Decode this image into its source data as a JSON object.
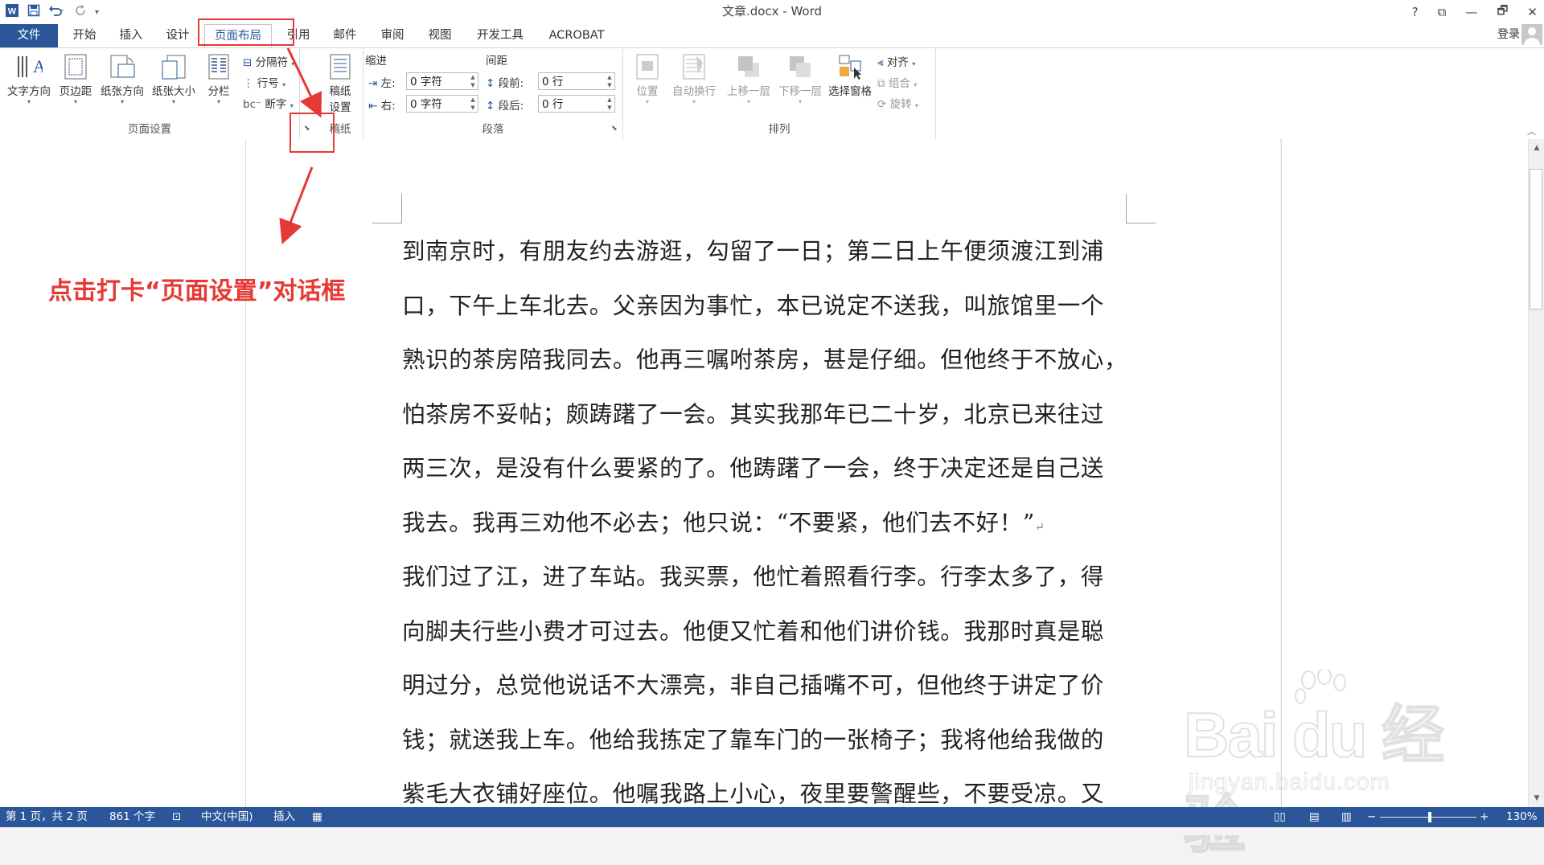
{
  "window": {
    "title": "文章.docx - Word",
    "controls": [
      "?",
      "⧉",
      "—",
      "🗗",
      "✕"
    ]
  },
  "tabs": [
    {
      "label": "文件",
      "active": false
    },
    {
      "label": "开始",
      "active": false
    },
    {
      "label": "插入",
      "active": false
    },
    {
      "label": "设计",
      "active": false
    },
    {
      "label": "页面布局",
      "active": true
    },
    {
      "label": "引用",
      "active": false
    },
    {
      "label": "邮件",
      "active": false
    },
    {
      "label": "审阅",
      "active": false
    },
    {
      "label": "视图",
      "active": false
    },
    {
      "label": "开发工具",
      "active": false
    },
    {
      "label": "ACROBAT",
      "active": false
    }
  ],
  "account": {
    "login": "登录"
  },
  "ribbon": {
    "page_setup": {
      "label": "页面设置",
      "text_direction": "文字方向",
      "margins": "页边距",
      "orientation": "纸张方向",
      "size": "纸张大小",
      "columns": "分栏",
      "breaks": "分隔符",
      "line_numbers": "行号",
      "hyphenation": "断字"
    },
    "draft_paper": {
      "label": "稿纸",
      "settings_line1": "稿纸",
      "settings_line2": "设置"
    },
    "paragraph": {
      "label": "段落",
      "indent_header": "缩进",
      "spacing_header": "间距",
      "indent_left_label": "左:",
      "indent_left_value": "0 字符",
      "indent_right_label": "右:",
      "indent_right_value": "0 字符",
      "spacing_before_label": "段前:",
      "spacing_before_value": "0 行",
      "spacing_after_label": "段后:",
      "spacing_after_value": "0 行"
    },
    "arrange": {
      "label": "排列",
      "position": "位置",
      "wrap_text": "自动换行",
      "bring_forward": "上移一层",
      "send_backward": "下移一层",
      "selection_pane": "选择窗格",
      "align": "对齐",
      "group": "组合",
      "rotate": "旋转"
    }
  },
  "document": {
    "lines": [
      "到南京时，有朋友约去游逛，勾留了一日；第二日上午便须渡江到浦",
      "口，下午上车北去。父亲因为事忙，本已说定不送我，叫旅馆里一个",
      "熟识的茶房陪我同去。他再三嘱咐茶房，甚是仔细。但他终于不放心，",
      "怕茶房不妥帖；颇踌躇了一会。其实我那年已二十岁，北京已来往过",
      "两三次，是没有什么要紧的了。他踌躇了一会，终于决定还是自己送",
      "我去。我再三劝他不必去；他只说：“不要紧，他们去不好！”",
      "我们过了江，进了车站。我买票，他忙着照看行李。行李太多了，得",
      "向脚夫行些小费才可过去。他便又忙着和他们讲价钱。我那时真是聪",
      "明过分，总觉他说话不大漂亮，非自己插嘴不可，但他终于讲定了价",
      "钱；就送我上车。他给我拣定了靠车门的一张椅子；我将他给我做的",
      "紫毛大衣铺好座位。他嘱我路上小心，夜里要警醒些，不要受凉。又"
    ],
    "paragraph_mark": "↵"
  },
  "status": {
    "page": "第 1 页，共 2 页",
    "words": "861 个字",
    "language": "中文(中国)",
    "mode": "插入",
    "zoom": "130%"
  },
  "annotation": {
    "text": "点击打卡“页面设置”对话框"
  },
  "watermark": {
    "logo_text": "Bai du 经验",
    "url_text": "jingyan.baidu.com"
  },
  "colors": {
    "accent": "#2b579a",
    "annotation_red": "#e53935"
  }
}
